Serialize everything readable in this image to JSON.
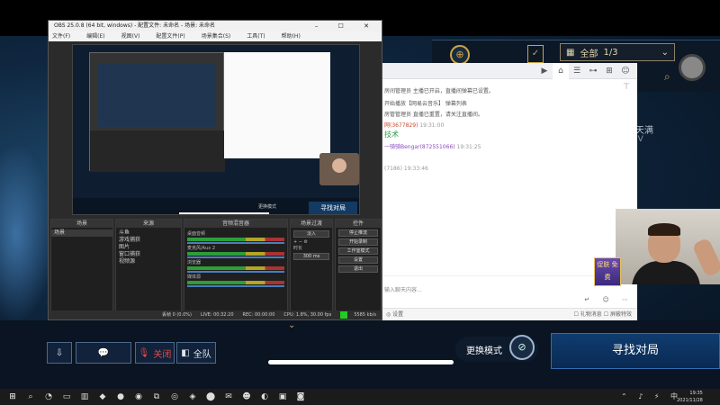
{
  "obs": {
    "title": "OBS 25.0.8 (64 bit, windows) - 配置文件: 未命名 - 场景: 未命名",
    "menu": [
      "文件(F)",
      "编辑(E)",
      "视图(V)",
      "配置文件(P)",
      "场景集合(S)",
      "工具(T)",
      "帮助(H)"
    ],
    "window_buttons": "– ☐ ✕",
    "docks": {
      "scenes": {
        "title": "场景",
        "items": [
          "场景"
        ]
      },
      "sources": {
        "title": "来源",
        "items": [
          "斗鱼",
          "游戏捕获",
          "图片",
          "窗口捕获",
          "视频源"
        ]
      },
      "mixer": {
        "title": "音频混音器",
        "channels": [
          "桌面音频",
          "麦克风/Aux 2",
          "浏览器",
          "媒体源"
        ]
      },
      "transitions": {
        "title": "场景过渡",
        "type": "淡入",
        "duration_label": "时长",
        "duration": "300 ms"
      },
      "controls": {
        "title": "控件",
        "buttons": [
          "停止推流",
          "开始录制",
          "工作室模式",
          "设置",
          "退出"
        ]
      }
    },
    "status": {
      "dropped": "丢帧 0 (0.0%)",
      "live": "LIVE: 00:32:20",
      "rec": "REC: 00:00:00",
      "cpu": "CPU: 1.8%, 30.00 fps",
      "bitrate": "5585 kb/s"
    },
    "preview": {
      "nested_button": "寻找对局",
      "nested_mode": "更换模式"
    },
    "dock_footer": "+ − ∧ ∨"
  },
  "game": {
    "region": "全部",
    "region_page": "1/3",
    "side_text1": "天满",
    "side_text2": "IV",
    "bottom": {
      "ally_btn": "⇩",
      "chat_btn": "💬",
      "mic_label": "关闭",
      "all_label": "全队",
      "mode_switch": "更换模式",
      "find_match": "寻找对局"
    }
  },
  "chat": {
    "messages": [
      {
        "user": "",
        "text": "房间管理员 主播已开启，直播间弹幕已设置。"
      },
      {
        "user": "",
        "text": "开始播放【网易云音乐】 弹幕列表"
      },
      {
        "user": "",
        "text": "房管管理员 直播已重置，请关注直播间。"
      },
      {
        "user": "网(3677829)",
        "text": "19:31:00"
      },
      {
        "user": "",
        "text": "技术"
      },
      {
        "user": "一骑骑Bengar(872551066)",
        "text": "19:31:25"
      },
      {
        "user": "(7186)",
        "text": "19:33:46"
      }
    ],
    "placeholder": "输入聊天内容...",
    "send_icons": "↵ ☺ ⋯",
    "footer_left": "◎ 设置",
    "footer_right": "☐ 礼物消息  ☐ 屏蔽特效"
  },
  "webcam": {
    "badge": "促肤 免费"
  },
  "taskbar": {
    "items": [
      "⊞",
      "⌕",
      "◔",
      "▭",
      "▥",
      "◆",
      "●",
      "◉",
      "⧉",
      "◎",
      "◈",
      "⬤",
      "✉",
      "☻",
      "◐",
      "▣",
      "◙"
    ],
    "tray": "⌃ ♪ ⚡ 中",
    "time": "19:35",
    "date": "2021/11/28"
  }
}
